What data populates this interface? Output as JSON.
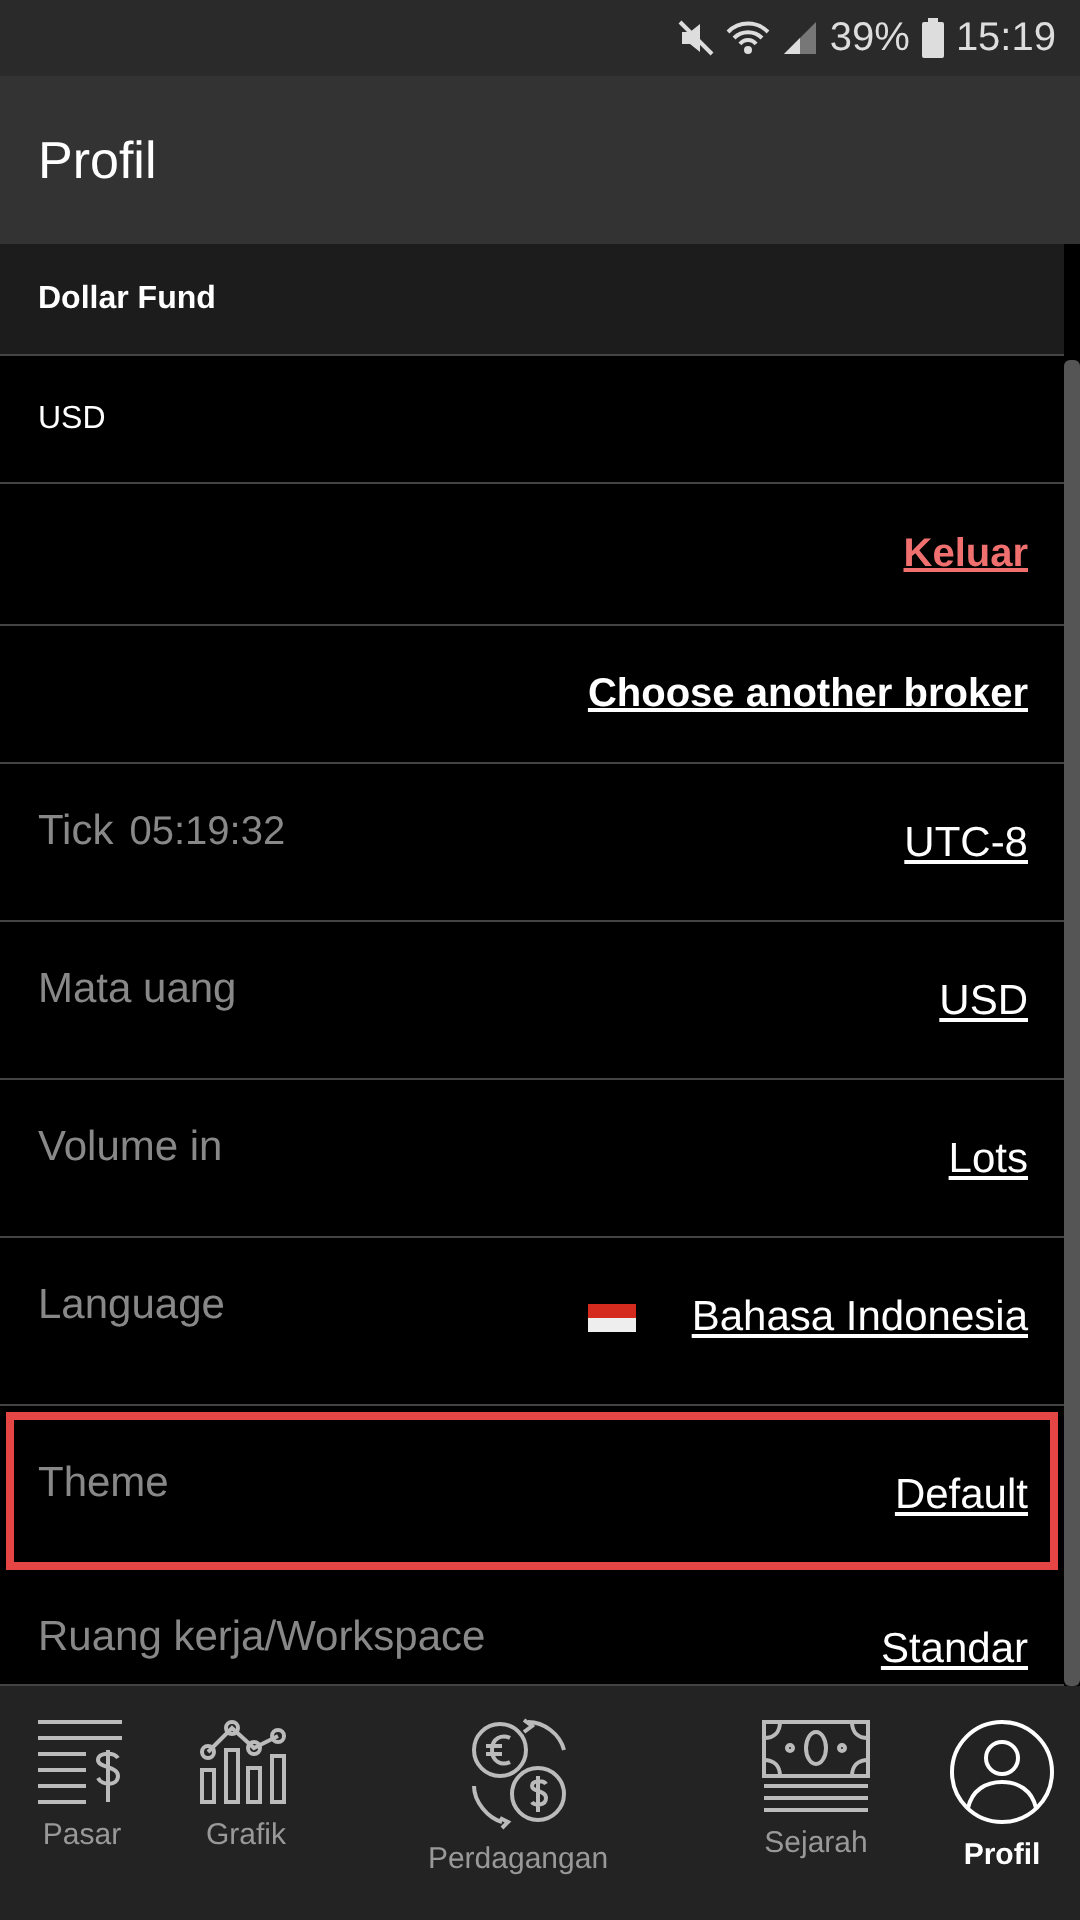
{
  "status_bar": {
    "battery": "39%",
    "time": "15:19"
  },
  "header": {
    "title": "Profil"
  },
  "account": {
    "name": "Dollar Fund",
    "currency": "USD"
  },
  "links": [
    {
      "label": "Keluar",
      "kind": "danger"
    },
    {
      "label": "Choose another broker",
      "kind": "bold"
    }
  ],
  "settings": [
    {
      "label": "Tick",
      "detail": "05:19:32",
      "value": "UTC-8",
      "highlighted": false
    },
    {
      "label": "Mata uang",
      "value": "USD",
      "highlighted": false
    },
    {
      "label": "Volume in",
      "value": "Lots",
      "highlighted": false
    },
    {
      "label": "Language",
      "value": "Bahasa Indonesia",
      "flag": true,
      "highlighted": false
    },
    {
      "label": "Theme",
      "value": "Default",
      "highlighted": true
    },
    {
      "label": "Ruang kerja/Workspace",
      "value": "Standar",
      "highlighted": false
    }
  ],
  "nav": [
    {
      "label": "Pasar",
      "kind": "market",
      "selected": false
    },
    {
      "label": "Grafik",
      "kind": "chart",
      "selected": false
    },
    {
      "label": "Perdagangan",
      "kind": "trade",
      "selected": false
    },
    {
      "label": "Sejarah",
      "kind": "history",
      "selected": false
    },
    {
      "label": "Profil",
      "kind": "profile",
      "selected": true
    }
  ]
}
